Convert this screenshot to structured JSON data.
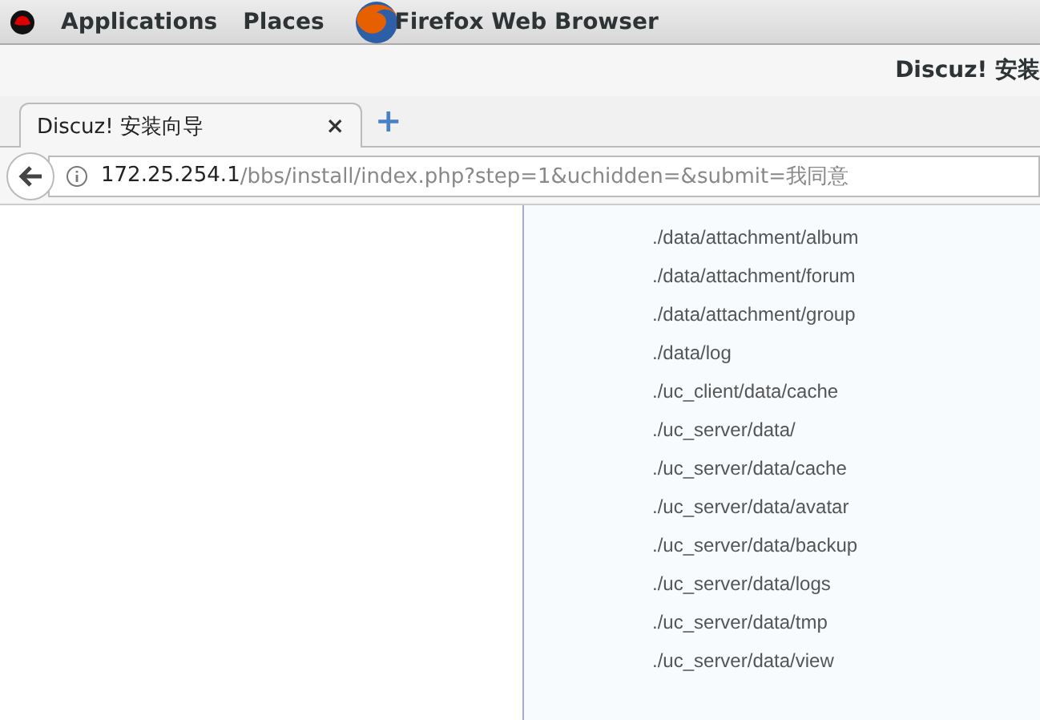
{
  "top_bar": {
    "menus": [
      "Applications",
      "Places"
    ],
    "app_name": "Firefox Web Browser"
  },
  "window": {
    "title": "Discuz! 安装"
  },
  "tabs": [
    {
      "label": "Discuz! 安装向导",
      "selected": true,
      "close": "×"
    }
  ],
  "new_tab": "+",
  "address_bar": {
    "host": "172.25.254.1",
    "path": "/bbs/install/index.php?step=1&uchidden=&submit=我同意"
  },
  "directories": [
    "./data/attachment/album",
    "./data/attachment/forum",
    "./data/attachment/group",
    "./data/log",
    "./uc_client/data/cache",
    "./uc_server/data/",
    "./uc_server/data/cache",
    "./uc_server/data/avatar",
    "./uc_server/data/backup",
    "./uc_server/data/logs",
    "./uc_server/data/tmp",
    "./uc_server/data/view"
  ]
}
